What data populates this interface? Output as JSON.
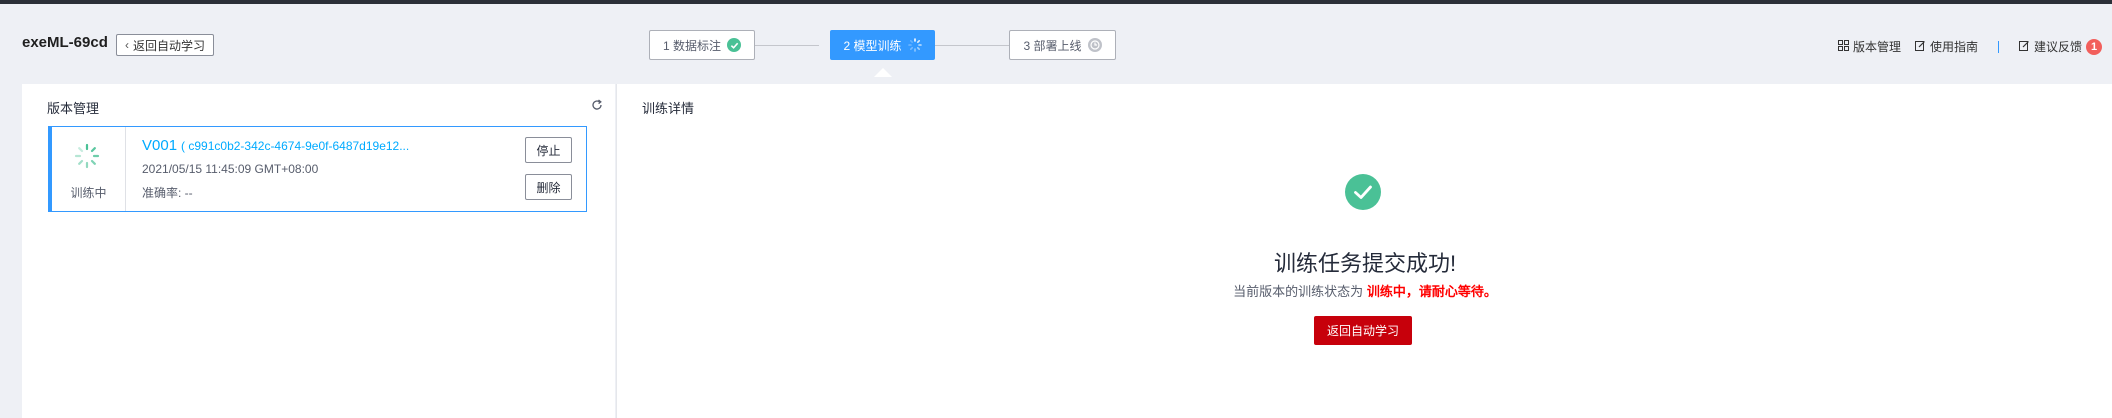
{
  "header": {
    "app_title": "exeML-69cd",
    "back_label": "返回自动学习",
    "steps": [
      {
        "label": "1 数据标注",
        "state": "done"
      },
      {
        "label": "2 模型训练",
        "state": "active"
      },
      {
        "label": "3 部署上线",
        "state": "pending"
      }
    ],
    "tools": {
      "version_mgmt": "版本管理",
      "guide": "使用指南",
      "feedback": "建议反馈",
      "feedback_badge": "1"
    }
  },
  "left_panel": {
    "title": "版本管理",
    "card": {
      "status_label": "训练中",
      "version": "V001",
      "version_id": "( c991c0b2-342c-4674-9e0f-6487d19e12...",
      "time": "2021/05/15 11:45:09 GMT+08:00",
      "accuracy": "准确率:   --",
      "stop_label": "停止",
      "delete_label": "删除"
    }
  },
  "right_panel": {
    "title": "训练详情",
    "success_title": "训练任务提交成功!",
    "sub_prefix": "当前版本的训练状态为",
    "sub_highlight": "训练中，请耐心等待。",
    "back_button": "返回自动学习"
  },
  "colors": {
    "accent": "#3399ff",
    "success": "#4ac196",
    "primary_button": "#c7000b",
    "highlight": "#ff0000"
  }
}
